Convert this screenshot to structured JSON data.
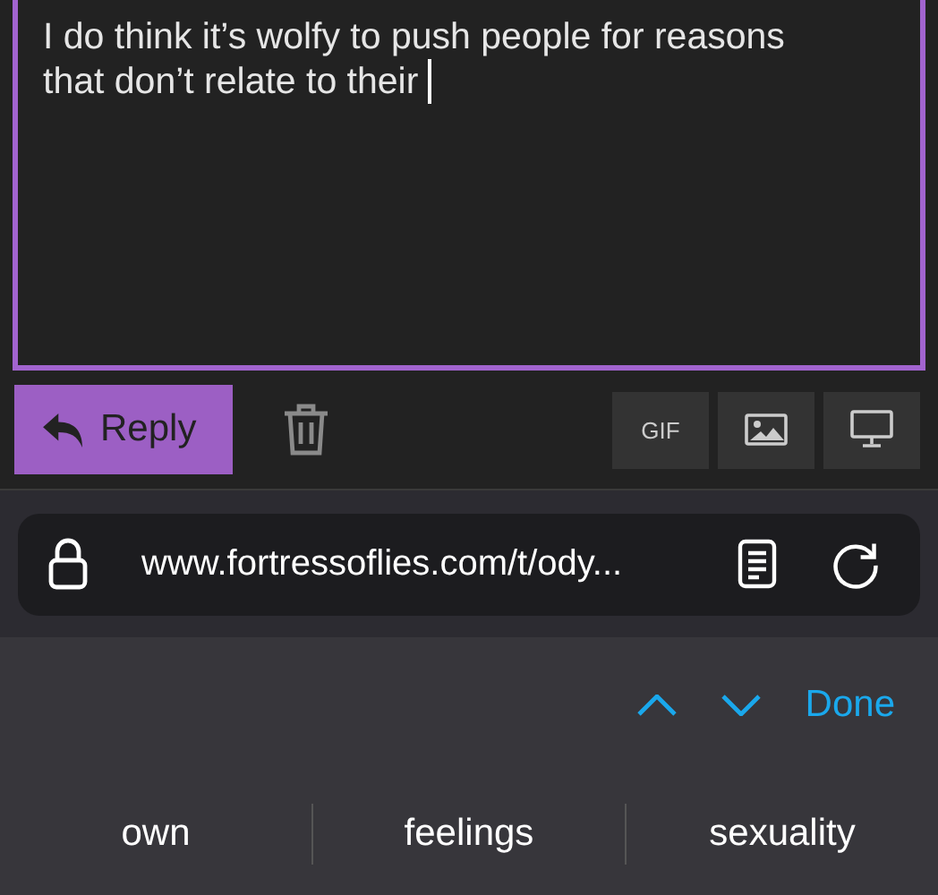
{
  "editor": {
    "value": "I do think it’s wolfy to push people for reasons that don’t relate to their"
  },
  "toolbar": {
    "reply_button": "Reply",
    "tools": [
      {
        "kind": "gif",
        "label": "GIF"
      },
      {
        "kind": "image"
      },
      {
        "kind": "preview"
      }
    ]
  },
  "address_bar": {
    "url": "www.fortressoflies.com/t/ody..."
  },
  "find_bar": {
    "done": "Done"
  },
  "suggestions": [
    "own",
    "feelings",
    "sexuality"
  ]
}
